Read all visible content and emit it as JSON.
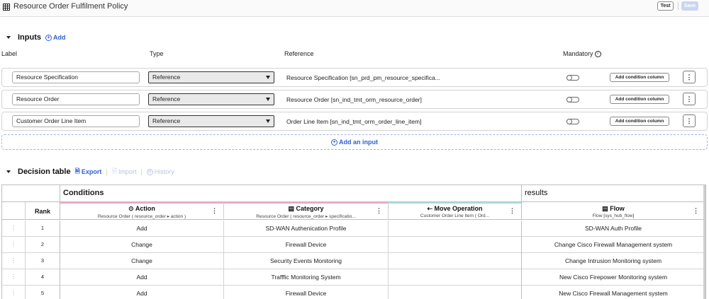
{
  "header": {
    "title": "Resource Order Fulfilment Policy",
    "title_icon": "table-icon",
    "test_label": "Test",
    "save_label": "Save"
  },
  "inputs": {
    "section_title": "Inputs",
    "add_label": "Add",
    "columns": {
      "label": "Label",
      "type": "Type",
      "reference": "Reference",
      "mandatory": "Mandatory"
    },
    "rows": [
      {
        "label": "Resource Specification",
        "type": "Reference",
        "reference": "Resource Specification [sn_prd_pm_resource_specifica...",
        "condition_btn": "Add condition column"
      },
      {
        "label": "Resource Order",
        "type": "Reference",
        "reference": "Resource Order [sn_ind_tmt_orm_resource_order]",
        "condition_btn": "Add condition column"
      },
      {
        "label": "Customer Order Line Item",
        "type": "Reference",
        "reference": "Order Line Item [sn_ind_tmt_orm_order_line_item]",
        "condition_btn": "Add condition column"
      }
    ],
    "add_input_label": "Add an input"
  },
  "decision_table": {
    "section_title": "Decision table",
    "export_label": "Export",
    "import_label": "Import",
    "history_label": "History",
    "group_conditions": "Conditions",
    "group_results": "results",
    "rank_header": "Rank",
    "columns": [
      {
        "title": "Action",
        "subtitle": "Resource Order ( resource_order ▸ action )",
        "icon": "⊙",
        "stripe": "#f4a6c9"
      },
      {
        "title": "Category",
        "subtitle": "Resource Order ( resource_order ▸ specificatio...",
        "icon": "▤",
        "stripe": "#f4a6c9"
      },
      {
        "title": "Move Operation",
        "subtitle": "Customer Order Line Item ( Ord...",
        "icon": "⇠",
        "stripe": "#a8dede"
      },
      {
        "title": "Flow",
        "subtitle": "Flow [sys_hub_flow]",
        "icon": "▤",
        "stripe": "#ffffff"
      }
    ],
    "rows": [
      {
        "rank": "1",
        "action": "Add",
        "category": "SD-WAN Authenication Profile",
        "move": "",
        "flow": "SD-WAN Auth Profile"
      },
      {
        "rank": "2",
        "action": "Change",
        "category": "Firewall Device",
        "move": "",
        "flow": "Change Cisco Firewall Management system"
      },
      {
        "rank": "3",
        "action": "Change",
        "category": "Security Events Monitoring",
        "move": "",
        "flow": "Change Intrusion Monitoring system"
      },
      {
        "rank": "4",
        "action": "Add",
        "category": "Trafffic Monitoring System",
        "move": "",
        "flow": "New Cisco Firepower Monitoring system"
      },
      {
        "rank": "5",
        "action": "Add",
        "category": "Firewall Device",
        "move": "",
        "flow": "New Cisco Firewall Management system"
      }
    ]
  },
  "colors": {
    "accent": "#2f5fd0",
    "save_disabled": "#c9d6ef",
    "condition_stripe": "#f4a6c9",
    "operation_stripe": "#a8dede"
  }
}
